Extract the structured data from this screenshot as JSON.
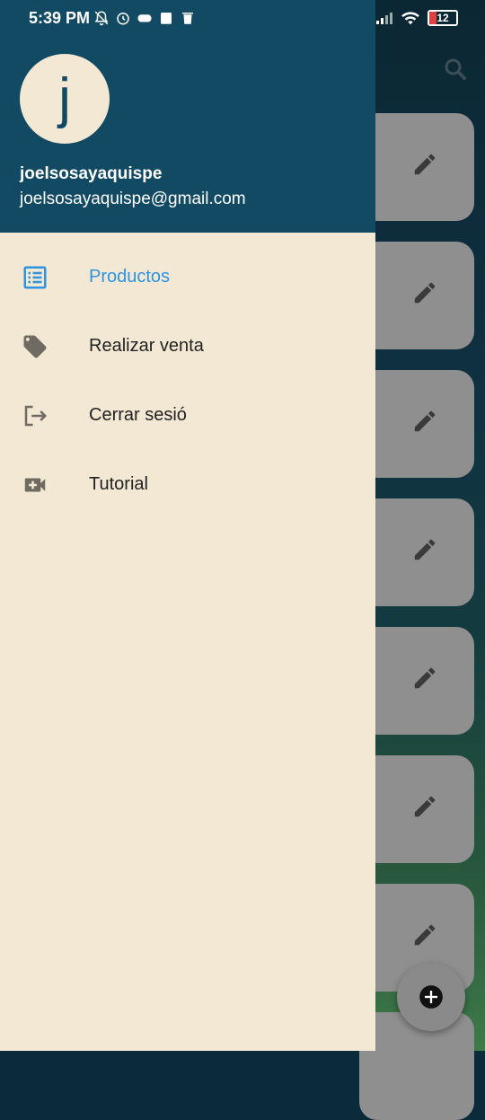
{
  "status_bar": {
    "time": "5:39 PM",
    "battery": "12"
  },
  "drawer": {
    "avatar_letter": "j",
    "user_name": "joelsosayaquispe",
    "user_email": "joelsosayaquispe@gmail.com",
    "items": [
      {
        "label": "Productos",
        "icon": "list-icon",
        "active": true
      },
      {
        "label": "Realizar venta",
        "icon": "tag-icon",
        "active": false
      },
      {
        "label": "Cerrar sesió",
        "icon": "logout-icon",
        "active": false
      },
      {
        "label": "Tutorial",
        "icon": "video-add-icon",
        "active": false
      }
    ]
  },
  "colors": {
    "header": "#124a64",
    "drawer_bg": "#f3e8d4",
    "active": "#2f93dd"
  }
}
